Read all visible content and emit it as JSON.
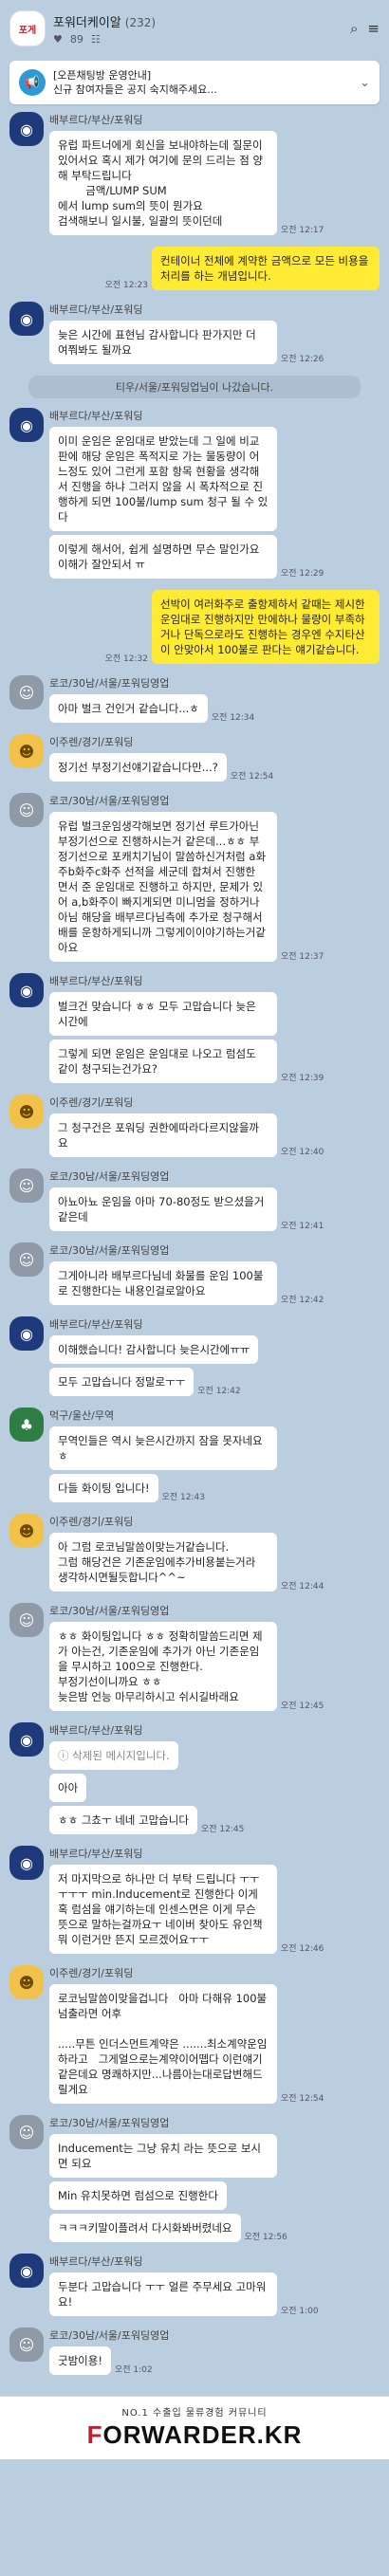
{
  "header": {
    "title": "포워더케이알",
    "member_count": "(232)",
    "likes": "89",
    "thumb_text": "포게"
  },
  "notice": {
    "title": "[오픈채팅방 운영안내]",
    "body": "신규 참여자들은 공지 숙지해주세요..."
  },
  "messages": [
    {
      "kind": "other",
      "sender": "배부르다/부산/포워딩",
      "av": "av-blue",
      "glyph": "◉",
      "bubbles": [
        {
          "text": "유럽 파트너에게 회신을 보내야하는데 질문이 있어서요 혹시 제가 여기에 문의 드리는 점 양해 부탁드립니다\n        금액/LUMP SUM\n에서 lump sum의 뜻이 뭔가요\n검색해보니 일시불, 일괄의 뜻이던데",
          "unread": "",
          "time": "오전 12:17"
        }
      ]
    },
    {
      "kind": "mine",
      "bubbles": [
        {
          "text": "컨테이너 전체에 계약한 금액으로 모든 비용을 처리를 하는 개념입니다.",
          "unread": "",
          "time": "오전 12:23"
        }
      ]
    },
    {
      "kind": "other",
      "sender": "배부르다/부산/포워딩",
      "av": "av-blue",
      "glyph": "◉",
      "bubbles": [
        {
          "text": "늦은 시간에 표현님 감사합니다 판가지만 더 여쭤봐도 될까요",
          "unread": "",
          "time": "오전 12:26"
        }
      ]
    },
    {
      "kind": "system",
      "text": "티우/서울/포워딩업님이 나갔습니다."
    },
    {
      "kind": "other",
      "sender": "배부르다/부산/포워딩",
      "av": "av-blue",
      "glyph": "◉",
      "bubbles": [
        {
          "text": "이미 운임은 운임대로 받았는데 그 일에 비교 판에 해당 운임은 폭적지로 가는 물동량이 어느정도 있어 그런게 포함 항목 현황을 생각해서 진행을 하냐 그러지 않을 시 폭차적으로 진행하게 되면 100불/lump sum 청구 될 수 있다",
          "unread": "",
          "time": ""
        },
        {
          "text": "이렇게 해서어, 쉽게 설명하면 무슨 말인가요 이해가 잘안되서 ㅠ",
          "unread": "",
          "time": "오전 12:29"
        }
      ]
    },
    {
      "kind": "mine",
      "bubbles": [
        {
          "text": "선박이 여러화주로 출항제하서 같때는 제시한 운임대로 진행하지만 만에하나 물량이 부족하거나 단독으로라도 진행하는 경우엔 수지타산이 안맞아서 100불로 판다는 얘기같습니다.",
          "unread": "",
          "time": "오전 12:32"
        }
      ]
    },
    {
      "kind": "other",
      "sender": "로코/30남/서울/포워딩영업",
      "av": "av-gray",
      "glyph": "☺",
      "bubbles": [
        {
          "text": "아마 벌크 건인거 같습니다...ㅎ",
          "unread": "",
          "time": "오전 12:34"
        }
      ]
    },
    {
      "kind": "other",
      "sender": "이주렌/경기/포워딩",
      "av": "av-yellow",
      "glyph": "☻",
      "bubbles": [
        {
          "text": "정기선 부정기선얘기같습니다만...?",
          "unread": "",
          "time": "오전 12:54"
        }
      ]
    },
    {
      "kind": "other",
      "sender": "로코/30남/서울/포워딩영업",
      "av": "av-gray",
      "glyph": "☺",
      "bubbles": [
        {
          "text": "유럽 벌크운임생각해보면 정기선 루트가아닌 부정기선으로 진행하시는거 같은데...ㅎㅎ 부정기선으로 포캐치기님이 말씀하신거처럼 a화주b화주c화주 선적을 세군데 합쳐서 진행한 면서 준 운임대로 진행하고 하지만, 문제가 있어 a,b화주이 빠지게되면 미니멈을 정하거나 아님 해당을 배부르다님측에 추가로 청구해서 배를 운항하게되니까 그렇게이이야기하는거같아요",
          "unread": "",
          "time": "오전 12:37"
        }
      ]
    },
    {
      "kind": "other",
      "sender": "배부르다/부산/포워딩",
      "av": "av-blue",
      "glyph": "◉",
      "bubbles": [
        {
          "text": "벌크건 맞습니다 ㅎㅎ 모두 고맙습니다 늦은 시간에",
          "unread": "",
          "time": ""
        },
        {
          "text": "그렇게 되면 운임은 운임대로 나오고 럼섬도 같이 청구되는건가요?",
          "unread": "",
          "time": "오전 12:39"
        }
      ]
    },
    {
      "kind": "other",
      "sender": "이주렌/경기/포워딩",
      "av": "av-yellow",
      "glyph": "☻",
      "bubbles": [
        {
          "text": "그 청구건은 포워딩 권한에따라다르지않을까요",
          "unread": "",
          "time": "오전 12:40"
        }
      ]
    },
    {
      "kind": "other",
      "sender": "로코/30남/서울/포워딩영업",
      "av": "av-gray",
      "glyph": "☺",
      "bubbles": [
        {
          "text": "아뇨아뇨 운임을 아마 70-80정도 받으셨을거 같은데",
          "unread": "",
          "time": "오전 12:41"
        }
      ]
    },
    {
      "kind": "other",
      "sender": "로코/30남/서울/포워딩영업",
      "av": "av-gray",
      "glyph": "☺",
      "bubbles": [
        {
          "text": "그게아니라 배부르다님네 화물를 운임 100불로 진행한다는 내용인걸로알아요",
          "unread": "",
          "time": "오전 12:42"
        }
      ]
    },
    {
      "kind": "other",
      "sender": "배부르다/부산/포워딩",
      "av": "av-blue",
      "glyph": "◉",
      "bubbles": [
        {
          "text": "이해했습니다! 감사합니다 늦은시간에ㅠㅠ",
          "unread": "",
          "time": ""
        },
        {
          "text": "모두 고맙습니다 정말로ㅜㅜ",
          "unread": "",
          "time": "오전 12:42"
        }
      ]
    },
    {
      "kind": "other",
      "sender": "먹구/울산/무역",
      "av": "av-green",
      "glyph": "♣",
      "bubbles": [
        {
          "text": "무역인들은 역시 늦은시간까지 잠을 못자네요 ㅎ",
          "unread": "",
          "time": ""
        },
        {
          "text": "다들 화이팅 입니다!",
          "unread": "",
          "time": "오전 12:43"
        }
      ]
    },
    {
      "kind": "other",
      "sender": "이주렌/경기/포워딩",
      "av": "av-yellow",
      "glyph": "☻",
      "bubbles": [
        {
          "text": "아 그럼 로코님말씀이맞는거같습니다.\n그럼 해당건은 기존운임에추가비용붙는거라 생각하시면될듯합니다^^~",
          "unread": "",
          "time": "오전 12:44"
        }
      ]
    },
    {
      "kind": "other",
      "sender": "로코/30남/서울/포워딩영업",
      "av": "av-gray",
      "glyph": "☺",
      "bubbles": [
        {
          "text": "ㅎㅎ 화이팅입니다 ㅎㅎ 정확히말씀드리면 제가 아는건, 기존운임에 추가가 아닌 기존운임을 무시하고 100으로 진행한다.\n부정기선이니까요 ㅎㅎ\n늦은밤 언능 마무리하시고 쉬시길바래요",
          "unread": "",
          "time": "오전 12:45"
        }
      ]
    },
    {
      "kind": "other",
      "sender": "배부르다/부산/포워딩",
      "av": "av-blue",
      "glyph": "◉",
      "bubbles": [
        {
          "text": "ⓘ 삭제된 메시지입니다.",
          "unread": "",
          "time": "",
          "deleted": true
        },
        {
          "text": "아아",
          "unread": "",
          "time": ""
        },
        {
          "text": "ㅎㅎ 그쵸ㅜ 네네 고맙습니다",
          "unread": "",
          "time": "오전 12:45"
        }
      ]
    },
    {
      "kind": "other",
      "sender": "배부르다/부산/포워딩",
      "av": "av-blue",
      "glyph": "◉",
      "bubbles": [
        {
          "text": "저 마지막으로 하나만 더 부탁 드립니다 ㅜㅜ\nㅜㅜㅜ min.Inducement로 진행한다 이게 혹 럼섬을 얘기하는데 인센스면은 이게 무슨 뜻으로 말하는걸까요ㅜ 네이버 찾아도 유인책 뭐 이런거만 뜬지 모르겠어요ㅜㅜ",
          "unread": "",
          "time": "오전 12:46"
        }
      ]
    },
    {
      "kind": "other",
      "sender": "이주렌/경기/포워딩",
      "av": "av-yellow",
      "glyph": "☻",
      "bubbles": [
        {
          "text": "로코님말씀이맞을겁니다   아마 다해유 100불 넘출라면 어후\n\n.....무튼 인더스먼트계약은 .......최소계약운임 하라고   그게얼으로는계약이어뗍다 이런얘기 같은데요 명쾌하지만...나름아는대로답변해드릴게요",
          "unread": "",
          "time": "오전 12:54"
        }
      ]
    },
    {
      "kind": "other",
      "sender": "로코/30남/서울/포워딩영업",
      "av": "av-gray",
      "glyph": "☺",
      "bubbles": [
        {
          "text": "Inducement는 그냥 유치 라는 뜻으로 보시면 되요",
          "unread": "",
          "time": ""
        },
        {
          "text": "Min 유치못하면 럼섬으로 진행한다",
          "unread": "",
          "time": ""
        },
        {
          "text": "ㅋㅋㅋ키말이플려서 다시화봐버렸네요",
          "unread": "",
          "time": "오전 12:56"
        }
      ]
    },
    {
      "kind": "other",
      "sender": "배부르다/부산/포워딩",
      "av": "av-blue",
      "glyph": "◉",
      "bubbles": [
        {
          "text": "두분다 고맙습니다 ㅜㅜ 얼른 주무세요 고마워요!",
          "unread": "",
          "time": "오전 1:00"
        }
      ]
    },
    {
      "kind": "other",
      "sender": "로코/30남/서울/포워딩영업",
      "av": "av-gray",
      "glyph": "☺",
      "bubbles": [
        {
          "text": "굿밤이용!",
          "unread": "",
          "time": "오전 1:02"
        }
      ]
    }
  ],
  "footer": {
    "tagline": "NO.1 수출입 물류경험 커뮤니티",
    "brand_f": "F",
    "brand_rest": "ORWARDER.KR"
  }
}
